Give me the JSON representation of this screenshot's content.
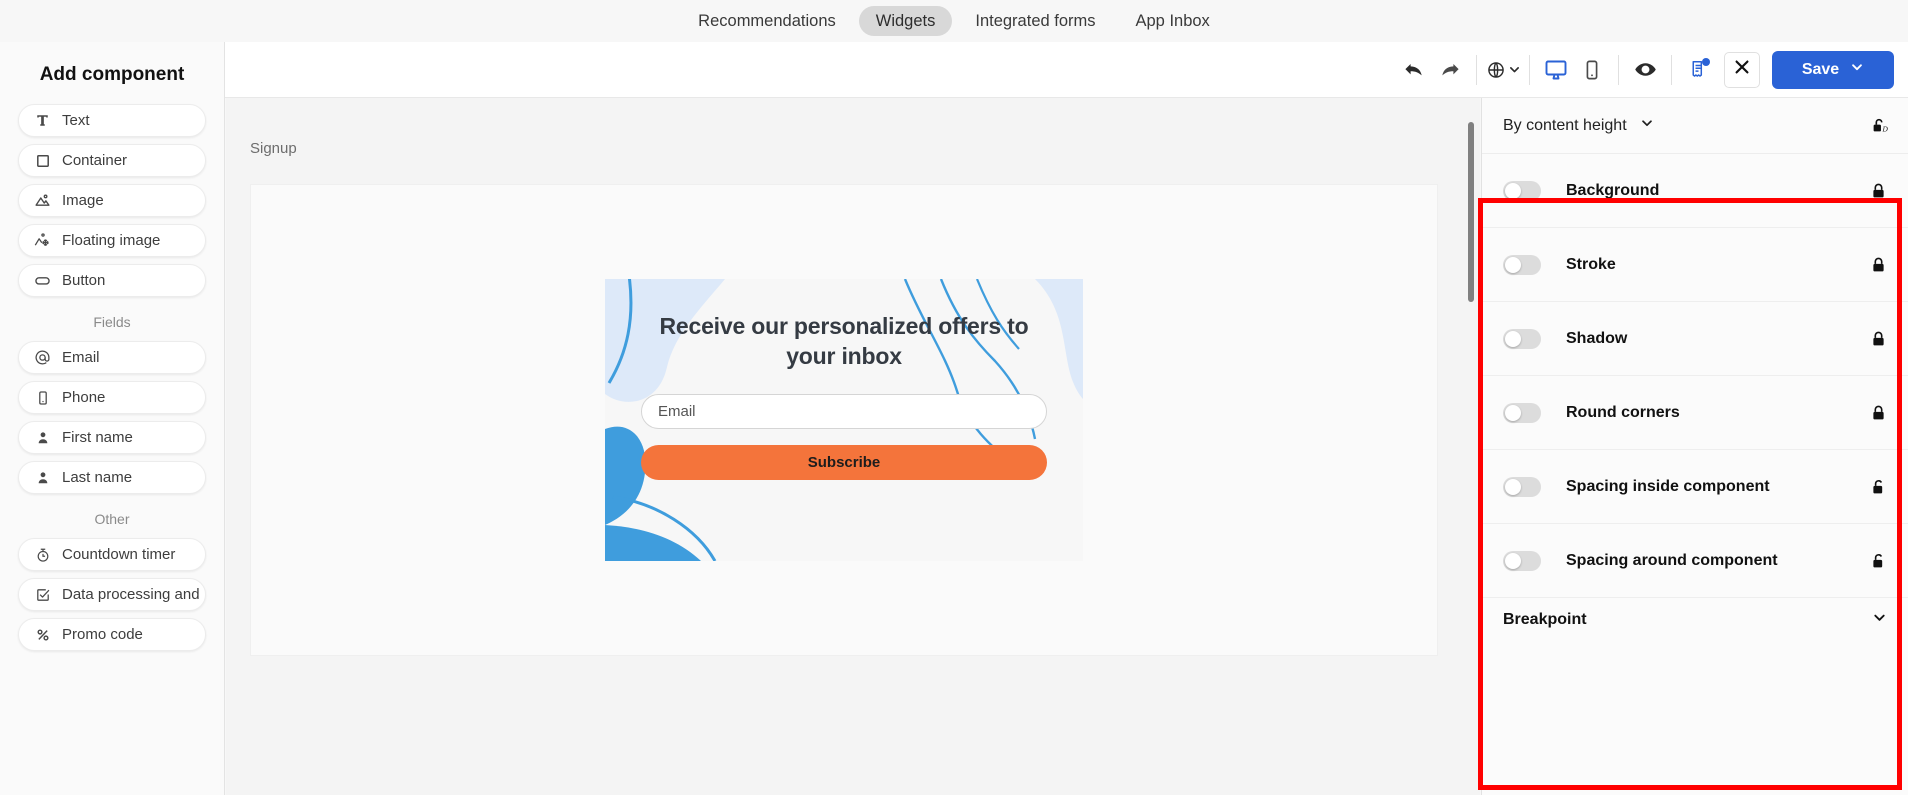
{
  "topbar": {
    "tabs": [
      {
        "label": "Recommendations",
        "active": false
      },
      {
        "label": "Widgets",
        "active": true
      },
      {
        "label": "Integrated forms",
        "active": false
      },
      {
        "label": "App Inbox",
        "active": false
      }
    ]
  },
  "sidebar": {
    "title": "Add component",
    "components": [
      {
        "label": "Text",
        "icon": "text-icon"
      },
      {
        "label": "Container",
        "icon": "container-icon"
      },
      {
        "label": "Image",
        "icon": "image-icon"
      },
      {
        "label": "Floating image",
        "icon": "floating-image-icon"
      },
      {
        "label": "Button",
        "icon": "button-icon"
      }
    ],
    "fields_label": "Fields",
    "fields": [
      {
        "label": "Email",
        "icon": "at-icon"
      },
      {
        "label": "Phone",
        "icon": "phone-icon"
      },
      {
        "label": "First name",
        "icon": "person-icon"
      },
      {
        "label": "Last name",
        "icon": "person-icon"
      }
    ],
    "other_label": "Other",
    "other": [
      {
        "label": "Countdown timer",
        "icon": "timer-icon"
      },
      {
        "label": "Data processing and",
        "icon": "checkbox-icon"
      },
      {
        "label": "Promo code",
        "icon": "percent-icon"
      }
    ]
  },
  "toolbar": {
    "undo": "undo-icon",
    "redo": "redo-icon",
    "language": "globe-icon",
    "desktop": "desktop-icon",
    "mobile": "mobile-icon",
    "preview": "eye-icon",
    "notes": "clipboard-icon",
    "close": "close-icon",
    "save_label": "Save"
  },
  "canvas": {
    "label": "Signup",
    "widget": {
      "title": "Receive our personalized offers to your inbox",
      "email_placeholder": "Email",
      "button_label": "Subscribe",
      "button_color": "#f4743b",
      "accent_blue": "#3f9ddd",
      "accent_blue_light": "#dde9f9"
    }
  },
  "right_panel": {
    "height_mode": "By content height",
    "lock_all_icon": "unlock-all-icon",
    "rows": [
      {
        "label": "Background",
        "toggle": "off",
        "lock": "locked"
      },
      {
        "label": "Stroke",
        "toggle": "off",
        "lock": "locked"
      },
      {
        "label": "Shadow",
        "toggle": "off",
        "lock": "locked"
      },
      {
        "label": "Round corners",
        "toggle": "off",
        "lock": "locked"
      },
      {
        "label": "Spacing inside component",
        "toggle": "off",
        "lock": "unlocked"
      },
      {
        "label": "Spacing around component",
        "toggle": "off",
        "lock": "unlocked"
      }
    ],
    "breakpoint_label": "Breakpoint",
    "highlight_color": "#ff0000"
  }
}
